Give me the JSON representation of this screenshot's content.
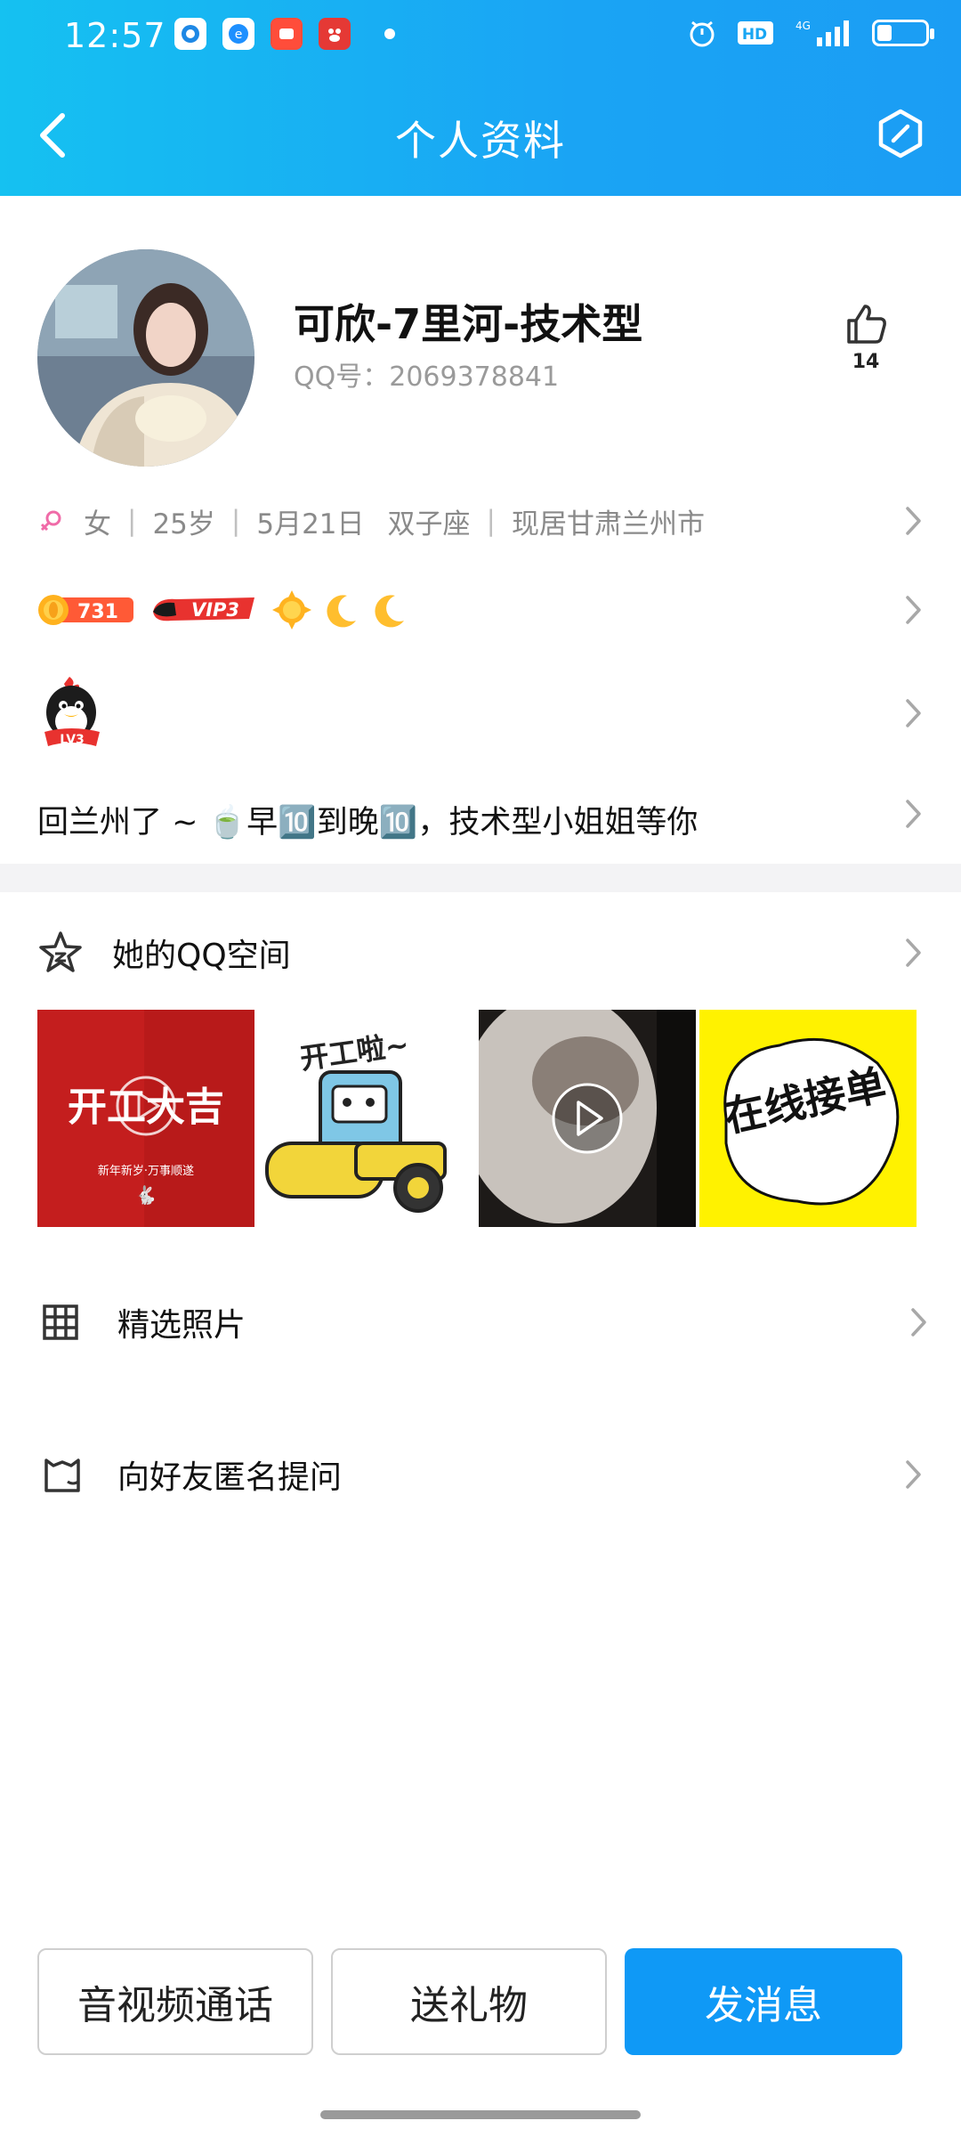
{
  "status_bar": {
    "time": "12:57",
    "network": "4G",
    "hd": "HD"
  },
  "nav": {
    "title": "个人资料"
  },
  "profile": {
    "name": "可欣-7里河-技术型",
    "qq_label": "QQ号：2069378841",
    "likes": "14"
  },
  "info_row": {
    "gender": "女",
    "age": "25岁",
    "birthday": "5月21日",
    "zodiac": "双子座",
    "location": "现居甘肃兰州市"
  },
  "badges": {
    "level_points": "731",
    "vip": "VIP3"
  },
  "penguin_level": "LV3",
  "signature": "回兰州了 ~ 🍵早🔟到晚🔟，技术型小姐姐等你",
  "qzone": {
    "title": "她的QQ空间",
    "thumbnails": [
      {
        "text": "开工大吉",
        "sub": "新年新岁·万事顺遂",
        "video": true
      },
      {
        "text": "开工啦~",
        "video": false
      },
      {
        "text": "",
        "video": true
      },
      {
        "text": "在线接单",
        "video": false
      }
    ]
  },
  "menu": {
    "photos": "精选照片",
    "ask": "向好友匿名提问"
  },
  "actions": {
    "call": "音视频通话",
    "gift": "送礼物",
    "message": "发消息"
  },
  "colors": {
    "accent": "#0f99f6",
    "header_start": "#15c1f1",
    "header_end": "#1b9df4"
  }
}
